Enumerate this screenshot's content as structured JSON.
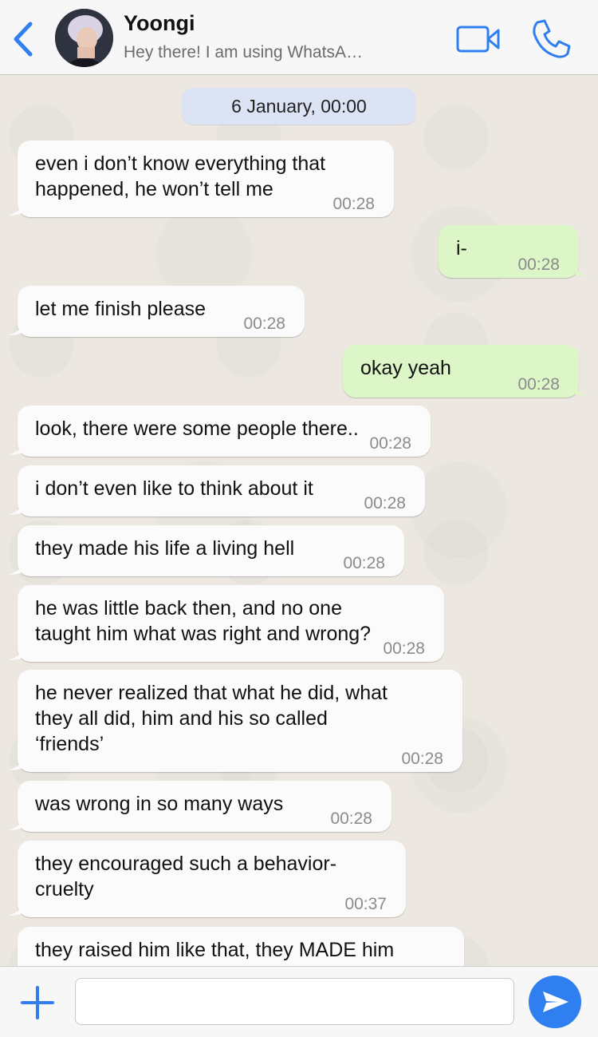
{
  "header": {
    "contact_name": "Yoongi",
    "status": "Hey there! I am using WhatsA…",
    "back_icon": "chevron-left-icon",
    "video_icon": "video-camera-icon",
    "call_icon": "phone-icon"
  },
  "chat": {
    "date_label": "6 January, 00:00",
    "messages": [
      {
        "dir": "in",
        "text": "even i don’t know everything that\nhappened, he won’t tell me",
        "time": "00:28"
      },
      {
        "dir": "out",
        "text": "i-",
        "time": "00:28"
      },
      {
        "dir": "in",
        "text": "let me finish please",
        "time": "00:28"
      },
      {
        "dir": "out",
        "text": "okay yeah",
        "time": "00:28"
      },
      {
        "dir": "in",
        "text": "look, there were some people there..",
        "time": "00:28"
      },
      {
        "dir": "in",
        "text": "i don’t even like to think about it",
        "time": "00:28"
      },
      {
        "dir": "in",
        "text": "they made his life a living hell",
        "time": "00:28"
      },
      {
        "dir": "in",
        "text": "he was little back then, and no one\ntaught him what was right and wrong?",
        "time": "00:28"
      },
      {
        "dir": "in",
        "text": "he never realized that what he did, what\nthey all did, him and his so called\n‘friends’",
        "time": "00:28"
      },
      {
        "dir": "in",
        "text": "was wrong in so many ways",
        "time": "00:28"
      },
      {
        "dir": "in",
        "text": "they encouraged such a behavior-\ncruelty",
        "time": "00:37"
      },
      {
        "dir": "in",
        "text": "they raised him like that, they MADE him",
        "time": ""
      }
    ]
  },
  "footer": {
    "input_placeholder": "",
    "plus_icon": "plus-icon",
    "send_icon": "send-arrow-icon"
  },
  "colors": {
    "accent": "#2f7ff0",
    "incoming_bubble": "#fbfbfb",
    "outgoing_bubble": "#dcf6c8",
    "date_chip": "#dce3f5"
  }
}
